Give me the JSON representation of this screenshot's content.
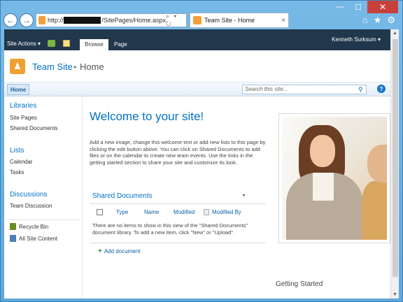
{
  "browser": {
    "url_prefix": "http://",
    "url_suffix": "/SitePages/Home.aspx",
    "url_tools": "⌕ ▾ ↻",
    "tab_title": "Team Site - Home",
    "tab_close": "×",
    "back_glyph": "←",
    "forward_glyph": "→",
    "home_glyph": "⌂",
    "favorites_glyph": "★",
    "tools_glyph": "⚙",
    "win_min": "—",
    "win_max": "☐",
    "win_close": "✕"
  },
  "ribbon": {
    "site_actions": "Site Actions ▾",
    "tabs": [
      "Browse",
      "Page"
    ],
    "user": "Kenneth Surksum ▾"
  },
  "header": {
    "site_title": "Team Site",
    "crumb_sep": "▸",
    "breadcrumb": "Home"
  },
  "topnav": {
    "home": "Home",
    "search_placeholder": "Search this site...",
    "help": "?"
  },
  "leftnav": {
    "sections": [
      {
        "heading": "Libraries",
        "items": [
          "Site Pages",
          "Shared Documents"
        ]
      },
      {
        "heading": "Lists",
        "items": [
          "Calendar",
          "Tasks"
        ]
      },
      {
        "heading": "Discussions",
        "items": [
          "Team Discussion"
        ]
      }
    ],
    "recycle_bin": "Recycle Bin",
    "all_site_content": "All Site Content"
  },
  "main": {
    "welcome": "Welcome to your site!",
    "intro": "Add a new image, change this welcome text or add new lists to this page by clicking the edit button above. You can click on Shared Documents to add files or on the calendar to create new team events. Use the links in the getting started section to share your site and customize its look.",
    "library": {
      "title": "Shared Documents",
      "menu_arrow": "▾",
      "columns": [
        "Type",
        "Name",
        "Modified",
        "Modified By"
      ],
      "empty_message": "There are no items to show in this view of the \"Shared Documents\" document library. To add a new item, click \"New\" or \"Upload\".",
      "add_label": "Add document"
    },
    "getting_started": "Getting Started"
  },
  "colors": {
    "accent": "#0072c6",
    "ribbon_bg": "#21374c",
    "frame": "#6fb3e0"
  }
}
